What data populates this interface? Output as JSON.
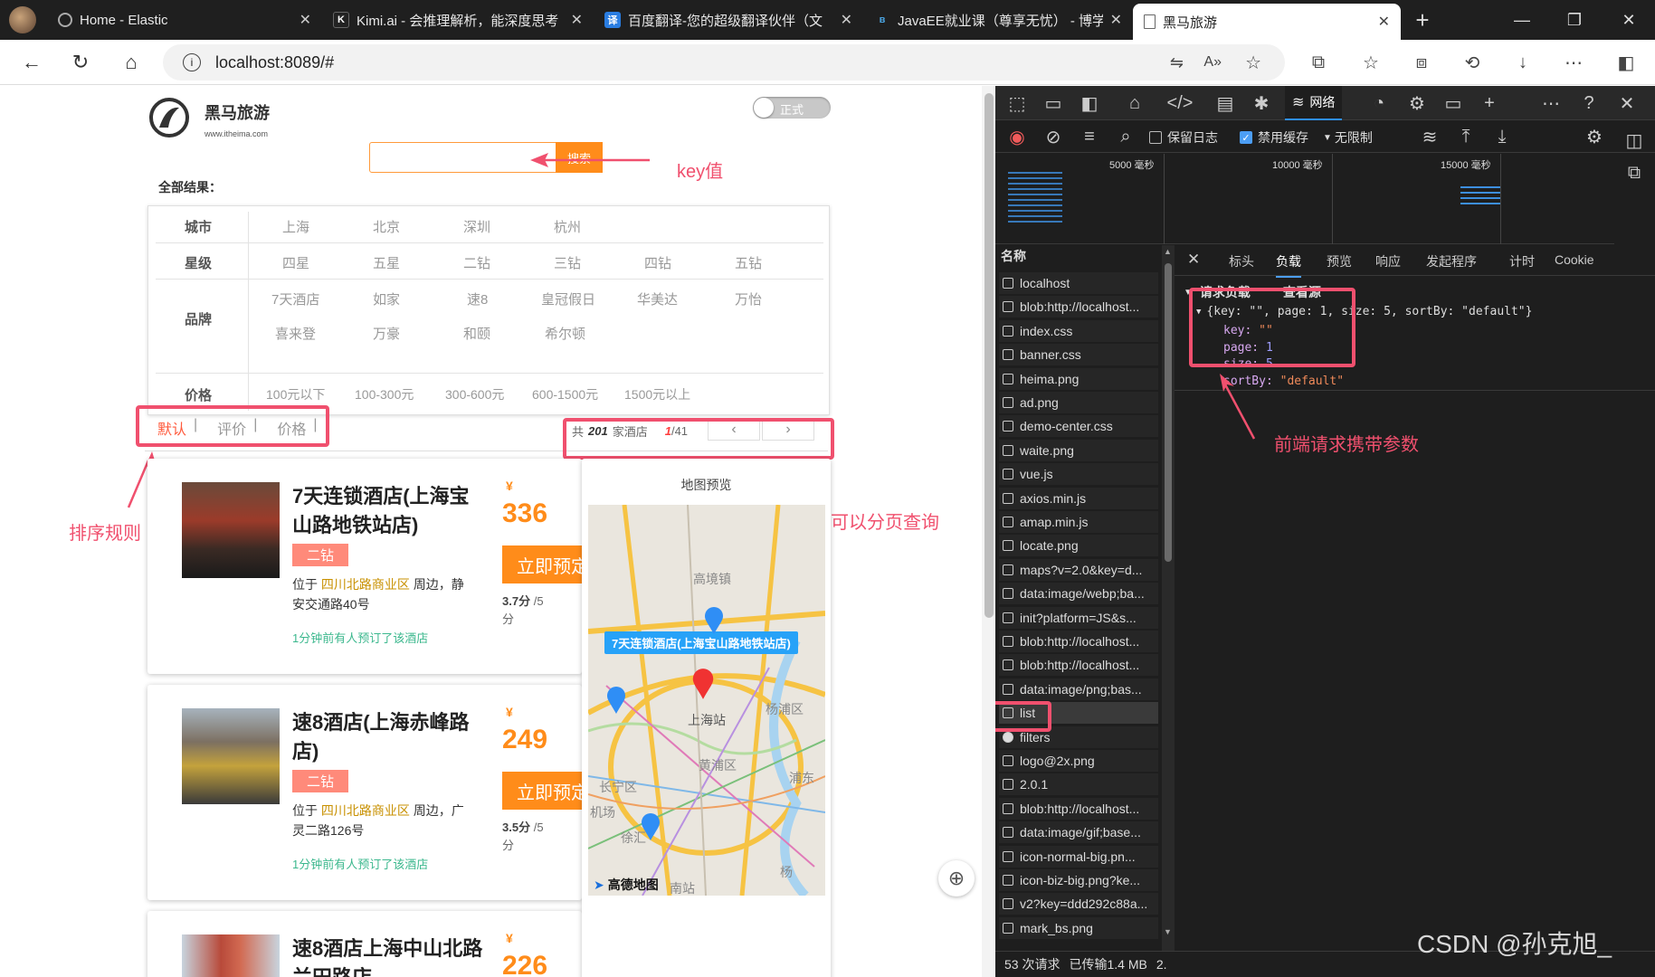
{
  "tabs": [
    {
      "title": "Home - Elastic",
      "fav": "elastic-icon"
    },
    {
      "title": "Kimi.ai - 会推理解析，能深度思考",
      "fav": "K"
    },
    {
      "title": "百度翻译-您的超级翻译伙伴（文",
      "fav": "译"
    },
    {
      "title": "JavaEE就业课（尊享无忧） - 博学",
      "fav": "bilibili"
    },
    {
      "title": "黑马旅游",
      "fav": "page-icon"
    }
  ],
  "url": "localhost:8089/#",
  "page": {
    "logo_title": "黑马旅游",
    "logo_sub": "www.itheima.com",
    "toggle_label": "正式",
    "search_button": "搜索",
    "all_results": "全部结果：",
    "filters": {
      "city_label": "城市",
      "cities": [
        "上海",
        "北京",
        "深圳",
        "杭州"
      ],
      "star_label": "星级",
      "stars": [
        "四星",
        "五星",
        "二钻",
        "三钻",
        "四钻",
        "五钻"
      ],
      "brand_label": "品牌",
      "brands_row1": [
        "7天酒店",
        "如家",
        "速8",
        "皇冠假日",
        "华美达",
        "万怡"
      ],
      "brands_row2": [
        "喜来登",
        "万豪",
        "和颐",
        "希尔顿"
      ],
      "price_label": "价格",
      "prices": [
        "100元以下",
        "100-300元",
        "300-600元",
        "600-1500元",
        "1500元以上"
      ]
    },
    "sort": {
      "default": "默认",
      "rating": "评价",
      "price": "价格",
      "sep": "|"
    },
    "pager": {
      "prefix": "共",
      "count": "201",
      "suffix": "家酒店",
      "page": "1",
      "total": "/41"
    },
    "map_title": "地图预览",
    "map_marker_label": "7天连锁酒店(上海宝山路地铁站店)",
    "map_places": [
      "高境镇",
      "上海站",
      "杨浦区",
      "黄浦区",
      "长宁区",
      "浦东",
      "机场",
      "徐汇",
      "南站",
      "杨"
    ],
    "map_logo": "高德地图",
    "hotels": [
      {
        "name_l1": "7天连锁酒店(上海宝",
        "name_l2": "山路地铁站店)",
        "badge": "二钻",
        "addr_prefix": "位于",
        "addr_area": "四川北路商业区",
        "addr_suffix_l1": "周边，静",
        "addr_l2": "安交通路40号",
        "recent": "1分钟前有人预订了该酒店",
        "currency": "¥",
        "price": "336",
        "score": "3.7分",
        "score_max": "/5",
        "score_unit": "分",
        "book": "立即预定"
      },
      {
        "name_l1": "速8酒店(上海赤峰路",
        "name_l2": "店)",
        "badge": "二钻",
        "addr_prefix": "位于",
        "addr_area": "四川北路商业区",
        "addr_suffix_l1": "周边，广",
        "addr_l2": "灵二路126号",
        "recent": "1分钟前有人预订了该酒店",
        "currency": "¥",
        "price": "249",
        "score": "3.5分",
        "score_max": "/5",
        "score_unit": "分",
        "book": "立即预定"
      },
      {
        "name_l1": "速8酒店上海中山北路",
        "name_l2": "兰田路店",
        "currency": "¥",
        "price": "226"
      }
    ]
  },
  "annotations": {
    "key": "key值",
    "sort": "排序规则",
    "page": "可以分页查询",
    "params": "前端请求携带参数"
  },
  "devtools": {
    "network_tab": "网络",
    "preserve_log": "保留日志",
    "disable_cache": "禁用缓存",
    "throttle": "无限制",
    "timeline": [
      "5000 毫秒",
      "10000 毫秒",
      "15000 毫秒"
    ],
    "name_header": "名称",
    "requests": [
      "localhost",
      "blob:http://localhost...",
      "index.css",
      "banner.css",
      "heima.png",
      "ad.png",
      "demo-center.css",
      "waite.png",
      "vue.js",
      "axios.min.js",
      "amap.min.js",
      "locate.png",
      "maps?v=2.0&key=d...",
      "data:image/webp;ba...",
      "init?platform=JS&s...",
      "blob:http://localhost...",
      "blob:http://localhost...",
      "data:image/png;bas...",
      "list",
      "filters",
      "logo@2x.png",
      "2.0.1",
      "blob:http://localhost...",
      "data:image/gif;base...",
      "icon-normal-big.pn...",
      "icon-biz-big.png?ke...",
      "v2?key=ddd292c88a...",
      "mark_bs.png"
    ],
    "detail_tabs": [
      "标头",
      "负载",
      "预览",
      "响应",
      "发起程序",
      "计时",
      "Cookie"
    ],
    "payload_title": "请求负载",
    "view_source": "查看源",
    "payload_summary": "{key: \"\", page: 1, size: 5, sortBy: \"default\"}",
    "payload": [
      {
        "k": "key:",
        "v": "\"\""
      },
      {
        "k": "page:",
        "v": "1"
      },
      {
        "k": "size:",
        "v": "5"
      },
      {
        "k": "sortBy:",
        "v": "\"default\""
      }
    ],
    "status_requests": "53 次请求",
    "status_transferred": "已传输1.4 MB",
    "status_more": "2."
  },
  "watermark": "CSDN @孙克旭_"
}
